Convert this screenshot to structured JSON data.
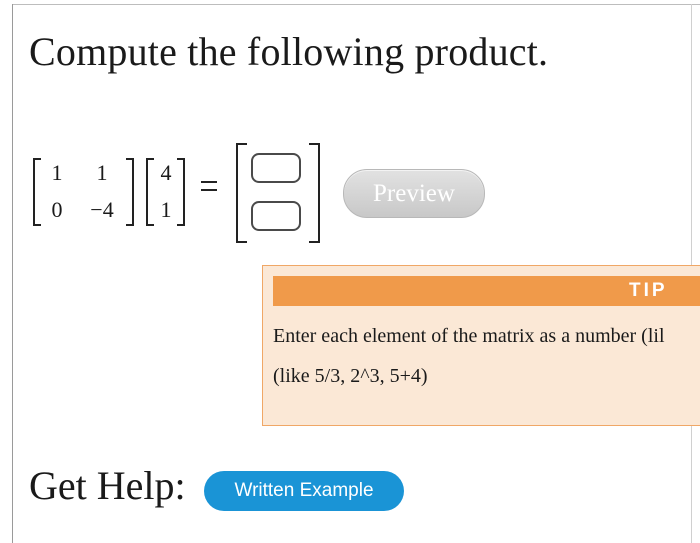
{
  "question": {
    "title": "Compute the following product."
  },
  "matrix_a": {
    "r1c1": "1",
    "r1c2": "1",
    "r2c1": "0",
    "r2c2": "−4"
  },
  "vector_b": {
    "r1": "4",
    "r2": "1"
  },
  "equals": "=",
  "answer": {
    "cell1_value": "",
    "cell2_value": ""
  },
  "preview_button": {
    "label": "Preview"
  },
  "tip": {
    "title": "TIP",
    "line1": "Enter each element of the matrix as a number (lil",
    "line2": "(like 5/3, 2^3, 5+4)"
  },
  "help": {
    "label": "Get Help:",
    "button_label": "Written Example"
  },
  "colors": {
    "tip_background": "#fbe8d6",
    "tip_header": "#f09a4a",
    "help_button": "#1a94d6",
    "preview_button": "#d4d4d4"
  }
}
